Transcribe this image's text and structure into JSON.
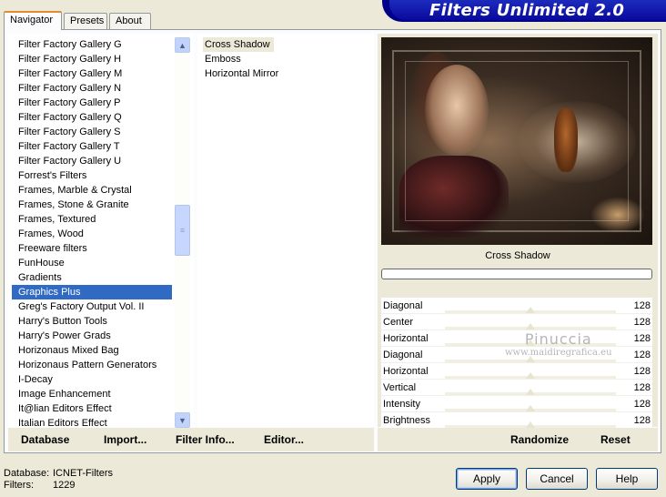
{
  "tabs": [
    "Navigator",
    "Presets",
    "About"
  ],
  "banner": {
    "title": "Filters Unlimited 2.0",
    "bg": "#0a0a9c"
  },
  "categories": [
    "Filter Factory Gallery G",
    "Filter Factory Gallery H",
    "Filter Factory Gallery M",
    "Filter Factory Gallery N",
    "Filter Factory Gallery P",
    "Filter Factory Gallery Q",
    "Filter Factory Gallery S",
    "Filter Factory Gallery T",
    "Filter Factory Gallery U",
    "Forrest's Filters",
    "Frames, Marble & Crystal",
    "Frames, Stone & Granite",
    "Frames, Textured",
    "Frames, Wood",
    "Freeware filters",
    "FunHouse",
    "Gradients",
    "Graphics Plus",
    "Greg's Factory Output Vol. II",
    "Harry's Button Tools",
    "Harry's Power Grads",
    "Horizonaus Mixed Bag",
    "Horizonaus Pattern Generators",
    "I-Decay",
    "Image Enhancement",
    "It@lian Editors Effect",
    "Italian Editors Effect"
  ],
  "selected_category": "Graphics Plus",
  "filters": [
    "Cross Shadow",
    "Emboss",
    "Horizontal Mirror"
  ],
  "selected_filter": "Cross Shadow",
  "preview": {
    "filter_name": "Cross Shadow"
  },
  "params": [
    {
      "label": "Diagonal",
      "value": "128",
      "level": 0.5
    },
    {
      "label": "Center",
      "value": "128",
      "level": 0.5
    },
    {
      "label": "Horizontal",
      "value": "128",
      "level": 0.5
    },
    {
      "label": "Diagonal",
      "value": "128",
      "level": 0.5
    },
    {
      "label": "Horizontal",
      "value": "128",
      "level": 0.5
    },
    {
      "label": "Vertical",
      "value": "128",
      "level": 0.5
    },
    {
      "label": "Intensity",
      "value": "128",
      "level": 0.5
    },
    {
      "label": "Brightness",
      "value": "128",
      "level": 0.5
    }
  ],
  "watermark": {
    "line1": "Pinuccia",
    "line2": "www.maidiregrafica.eu"
  },
  "toolbar": {
    "database": "Database",
    "import": "Import...",
    "filter_info": "Filter Info...",
    "editor": "Editor...",
    "randomize": "Randomize",
    "reset": "Reset"
  },
  "footer": {
    "database_label": "Database:",
    "database_value": "ICNET-Filters",
    "filters_label": "Filters:",
    "filters_value": "1229",
    "apply": "Apply",
    "cancel": "Cancel",
    "help": "Help"
  }
}
